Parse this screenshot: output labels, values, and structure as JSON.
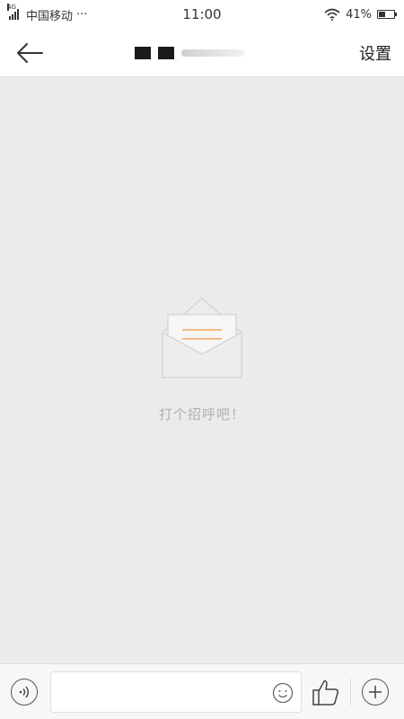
{
  "status_bar": {
    "network_type": "4G",
    "carrier": "中国移动",
    "more": "···",
    "time": "11:00",
    "battery": "41%",
    "battery_level": 0.41
  },
  "header": {
    "settings_label": "设置"
  },
  "empty_state": {
    "message": "打个招呼吧！"
  },
  "colors": {
    "background": "#ebebeb",
    "envelope_accent": "#f5a55a",
    "envelope_stroke": "#d6d6d6"
  },
  "icons": {
    "back": "arrow-left-icon",
    "voice": "voice-icon",
    "emoji": "smiley-icon",
    "like": "thumbs-up-icon",
    "plus": "plus-icon",
    "envelope": "envelope-icon"
  }
}
